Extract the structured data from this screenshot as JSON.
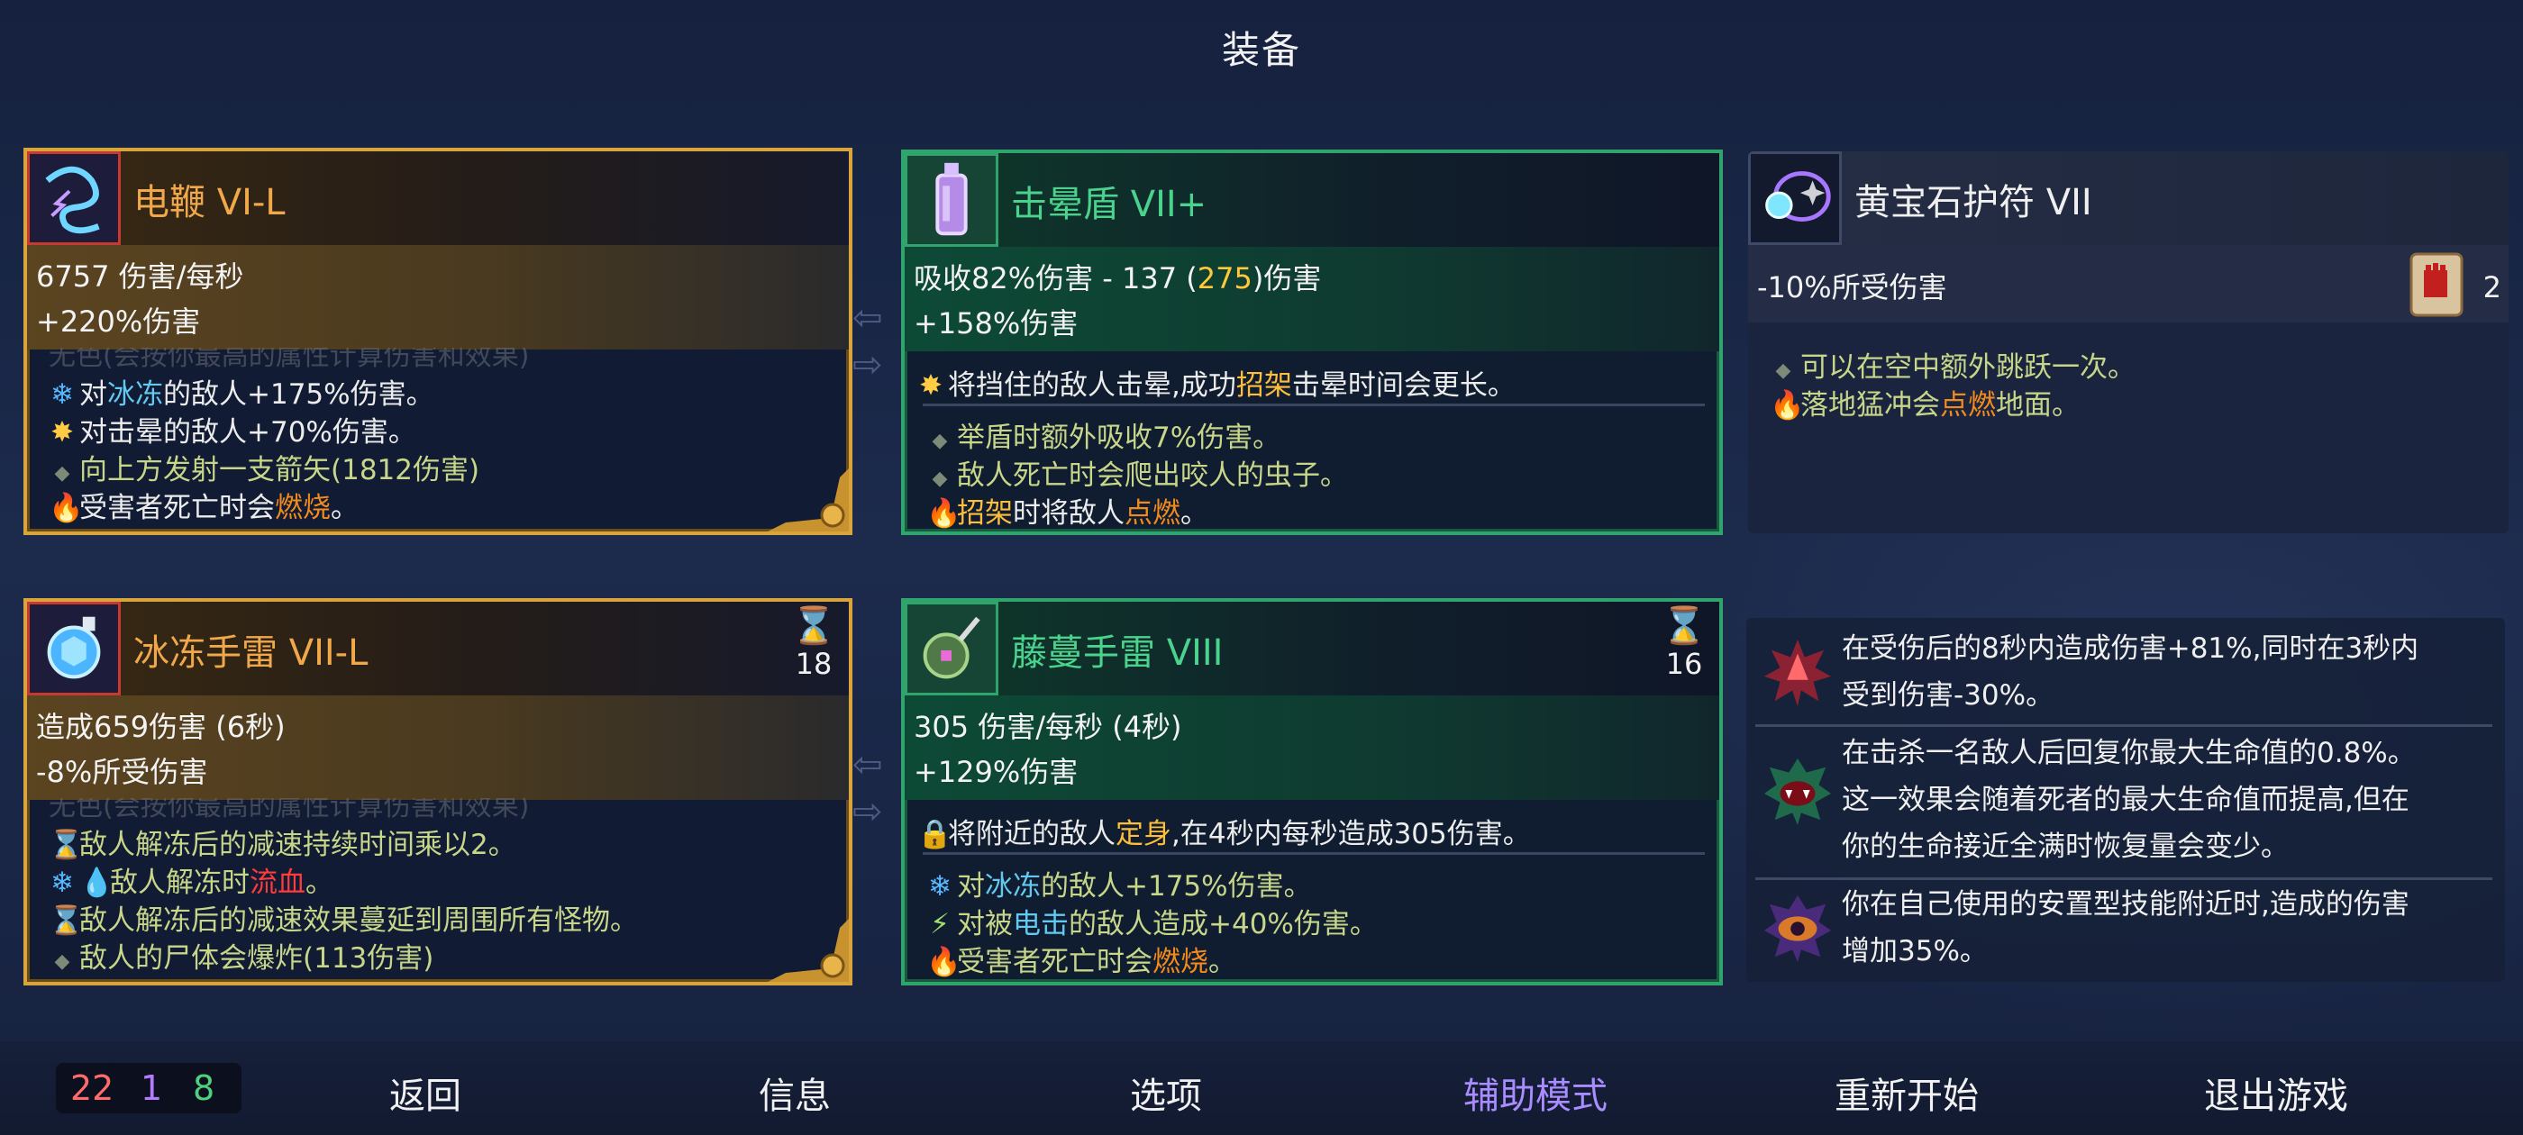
{
  "title": "装备",
  "items": {
    "whip": {
      "name": "电鞭 VI-L",
      "stat1": "6757 伤害/每秒",
      "stat2": "+220%伤害",
      "faded": "无色(会按你最高的属性计算伤害和效果)",
      "affixes": [
        {
          "pre": "对",
          "hl": "冰冻",
          "post": "的敌人+175%伤害。"
        },
        {
          "pre": "对击晕的敌人+70%伤害。"
        },
        {
          "pre": "向上方发射一支箭矢(1812伤害)"
        },
        {
          "pre": "受害者死亡时会",
          "hl": "燃烧",
          "post": "。"
        }
      ]
    },
    "shield": {
      "name": "击晕盾 VII+",
      "stat1_a": "吸收82%伤害 - 137 (",
      "stat1_b": "275",
      "stat1_c": ")伤害",
      "stat2": "+158%伤害",
      "main": {
        "pre": "将挡住的敌人击晕,成功",
        "hl": "招架",
        "post": "击晕时间会更长。"
      },
      "affixes": [
        {
          "pre": "举盾时额外吸收7%伤害。"
        },
        {
          "pre": "敌人死亡时会爬出咬人的虫子。"
        },
        {
          "pre": "招架",
          "hl": "",
          "post": "时将敌人",
          "hl2": "点燃",
          "post2": "。"
        }
      ]
    },
    "amulet": {
      "name": "黄宝石护符 VII",
      "stat1": "-10%所受伤害",
      "scroll_count": "2",
      "affixes": [
        {
          "pre": "可以在空中额外跳跃一次。"
        },
        {
          "pre": "落地猛冲会",
          "hl": "点燃",
          "post": "地面。"
        }
      ]
    },
    "grenade": {
      "name": "冰冻手雷 VII-L",
      "cooldown": "18",
      "stat1": "造成659伤害 (6秒)",
      "stat2": "-8%所受伤害",
      "faded": "无色(会按你最高的属性计算伤害和效果)",
      "affixes": [
        {
          "pre": "敌人解冻后的减速持续时间乘以2。"
        },
        {
          "pre": "敌人解冻时",
          "hl": "流血",
          "post": "。"
        },
        {
          "pre": "敌人解冻后的减速效果蔓延到周围所有怪物。"
        },
        {
          "pre": "敌人的尸体会爆炸(113伤害)"
        }
      ]
    },
    "vine": {
      "name": "藤蔓手雷 VIII",
      "cooldown": "16",
      "stat1": "305 伤害/每秒 (4秒)",
      "stat2": "+129%伤害",
      "main": {
        "pre": "将附近的敌人",
        "hl": "定身",
        "post": ",在4秒内每秒造成305伤害。"
      },
      "affixes": [
        {
          "pre": "对",
          "hl": "冰冻",
          "post": "的敌人+175%伤害。"
        },
        {
          "pre": "对被",
          "hl": "电击",
          "post": "的敌人造成+40%伤害。"
        },
        {
          "pre": "受害者死亡时会",
          "hl": "燃烧",
          "post": "。"
        }
      ]
    }
  },
  "mutations": [
    {
      "icon": "rage-spikes-icon",
      "line1": "在受伤后的8秒内造成伤害+81%,同时在3秒内",
      "line2": "受到伤害-30%。"
    },
    {
      "icon": "vampire-mouth-icon",
      "line1": "在击杀一名敌人后回复你最大生命值的0.8%。",
      "line2": "这一效果会随着死者的最大生命值而提高,但在",
      "line3": "你的生命接近全满时恢复量会变少。"
    },
    {
      "icon": "eye-trap-icon",
      "line1": "你在自己使用的安置型技能附近时,造成的伤害",
      "line2": "增加35%。"
    }
  ],
  "scrolls": {
    "brutality": "22",
    "tactics": "1",
    "survival": "8"
  },
  "menu": {
    "back": "返回",
    "info": "信息",
    "options": "选项",
    "assist": "辅助模式",
    "restart": "重新开始",
    "quit": "退出游戏"
  },
  "colors": {
    "brutality": "#d9a43c",
    "tactics": "#2fa46d",
    "brutality_count": "#ff6b6b",
    "tactics_count": "#b37cff",
    "survival_count": "#4fd07c",
    "assist": "#a98cff"
  }
}
